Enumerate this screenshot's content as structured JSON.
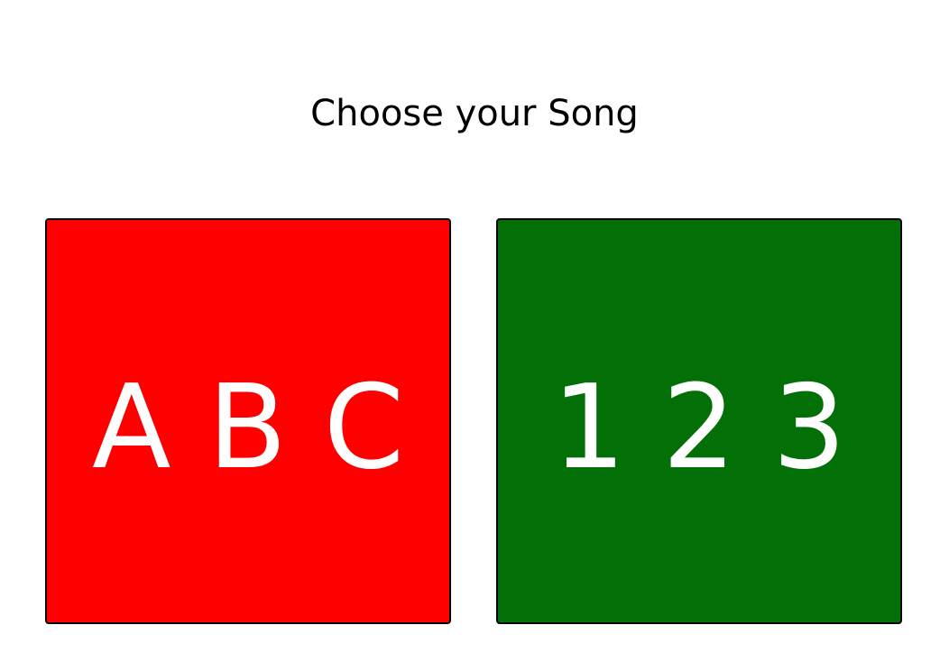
{
  "header": {
    "title": "Choose your Song"
  },
  "songs": [
    {
      "label": "A B C",
      "color": "#ff0000"
    },
    {
      "label": "1 2 3",
      "color": "#027006"
    }
  ]
}
